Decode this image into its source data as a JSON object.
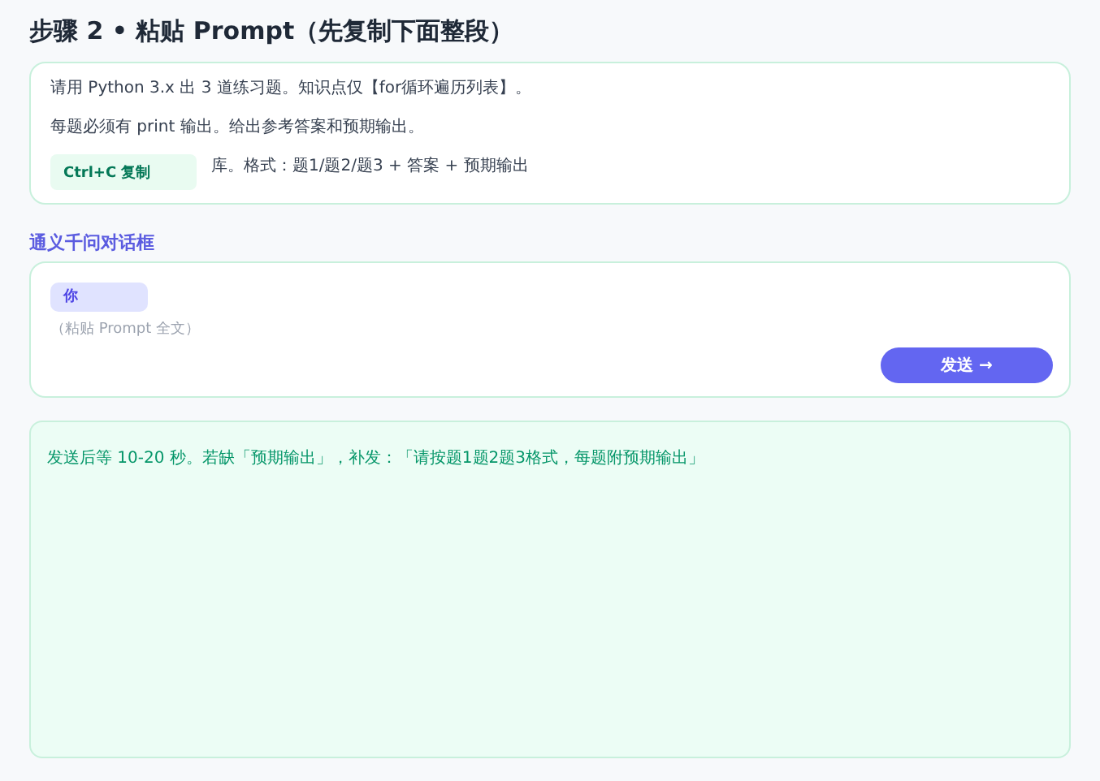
{
  "title": "步骤 2 • 粘贴 Prompt（先复制下面整段）",
  "prompt": {
    "lines": [
      "请用 Python 3.x 出 3 道练习题。知识点仅【for循环遍历列表】。",
      "每题必须有 print 输出。给出参考答案和预期输出。",
      "库。格式：题1/题2/题3 + 答案 + 预期输出"
    ],
    "copy_badge": "Ctrl+C 复制"
  },
  "chat": {
    "label": "通义千问对话框",
    "speaker": "你",
    "placeholder": "（粘贴 Prompt 全文）",
    "send_button": "发送 →"
  },
  "note": "发送后等 10-20 秒。若缺「预期输出」，补发：「请按题1题2题3格式，每题附预期输出」"
}
